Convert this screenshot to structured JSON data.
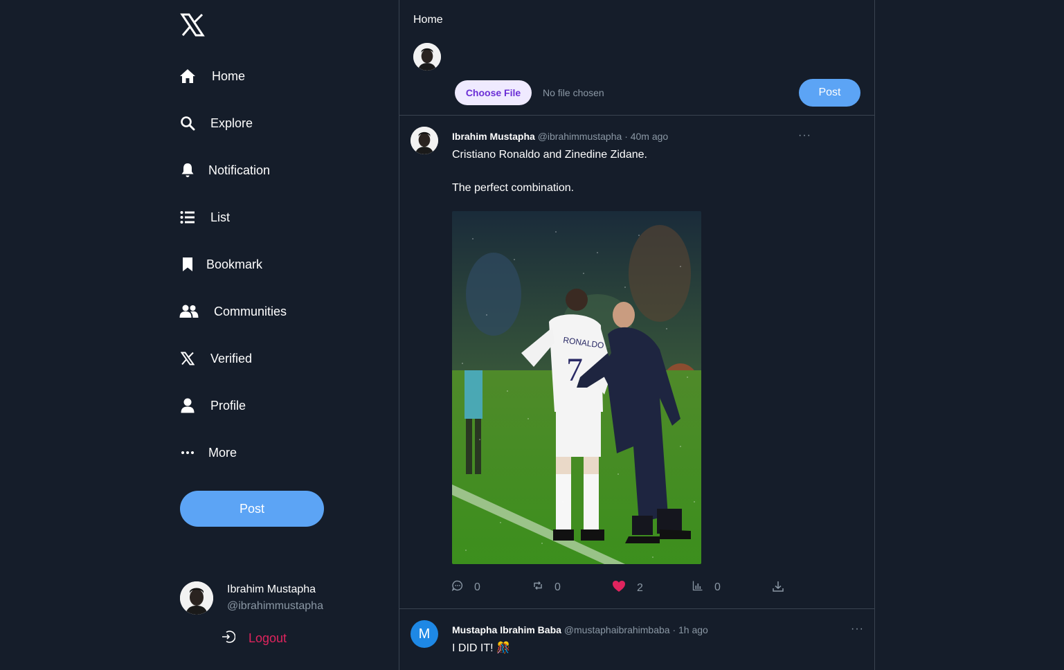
{
  "sidebar": {
    "logo_icon": "x-logo-icon",
    "items": [
      {
        "label": "Home",
        "icon": "home-icon"
      },
      {
        "label": "Explore",
        "icon": "search-icon"
      },
      {
        "label": "Notification",
        "icon": "bell-icon"
      },
      {
        "label": "List",
        "icon": "list-icon"
      },
      {
        "label": "Bookmark",
        "icon": "bookmark-icon"
      },
      {
        "label": "Communities",
        "icon": "users-icon"
      },
      {
        "label": "Verified",
        "icon": "x-icon"
      },
      {
        "label": "Profile",
        "icon": "user-icon"
      },
      {
        "label": "More",
        "icon": "more-dots-icon"
      }
    ],
    "post_label": "Post",
    "user": {
      "name": "Ibrahim Mustapha",
      "handle": "@ibrahimmustapha"
    },
    "logout_label": "Logout"
  },
  "feed": {
    "title": "Home",
    "compose": {
      "choose_file_label": "Choose File",
      "no_file_text": "No file chosen",
      "post_label": "Post"
    },
    "tweets": [
      {
        "name": "Ibrahim Mustapha",
        "handle": "@ibrahimmustapha",
        "time": "· 40m ago",
        "text_line1": "Cristiano Ronaldo and Zinedine Zidane.",
        "text_line2": "The perfect combination.",
        "more": "···",
        "comments": "0",
        "reposts": "0",
        "likes": "2",
        "views": "0"
      },
      {
        "avatar_letter": "M",
        "name": "Mustapha Ibrahim Baba",
        "handle": "@mustaphaibrahimbaba",
        "time": "· 1h ago",
        "text": "I DID IT! 🎊",
        "more": "···"
      }
    ]
  },
  "colors": {
    "background": "#151d2a",
    "accent": "#5ca4f5",
    "like": "#e0245e",
    "muted": "#8b98a5"
  }
}
